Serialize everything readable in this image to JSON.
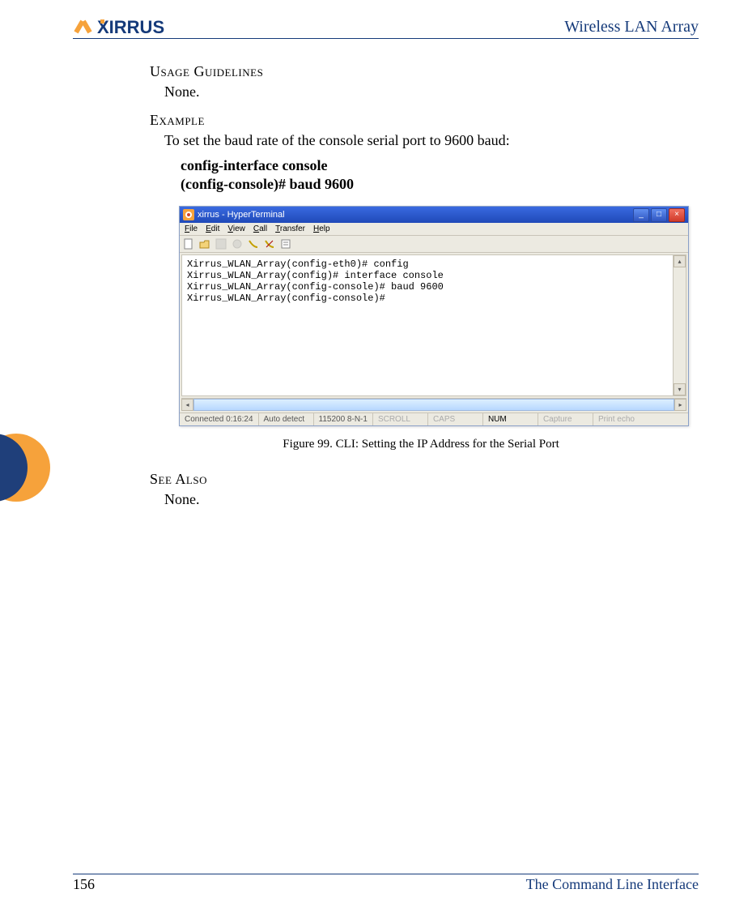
{
  "header": {
    "brand": "XIRRUS",
    "title": "Wireless LAN Array"
  },
  "sections": {
    "usage_h": "Usage Guidelines",
    "usage_body": "None.",
    "example_h": "Example",
    "example_body": "To set the baud rate of the console serial port to 9600 baud:",
    "cmd1": "config-interface console",
    "cmd2": "(config-console)# baud 9600",
    "seealso_h": "See Also",
    "seealso_body": "None.",
    "figure_caption": "Figure 99. CLI: Setting the IP Address for the Serial Port"
  },
  "terminal": {
    "title": "xirrus - HyperTerminal",
    "menu": [
      "File",
      "Edit",
      "View",
      "Call",
      "Transfer",
      "Help"
    ],
    "lines": [
      "Xirrus_WLAN_Array(config-eth0)# config",
      "Xirrus_WLAN_Array(config)# interface console",
      "Xirrus_WLAN_Array(config-console)# baud 9600",
      "Xirrus_WLAN_Array(config-console)#"
    ],
    "status": {
      "connected": "Connected 0:16:24",
      "detect": "Auto detect",
      "serial": "115200 8-N-1",
      "scroll": "SCROLL",
      "caps": "CAPS",
      "num": "NUM",
      "capture": "Capture",
      "echo": "Print echo"
    }
  },
  "footer": {
    "page": "156",
    "section": "The Command Line Interface"
  }
}
